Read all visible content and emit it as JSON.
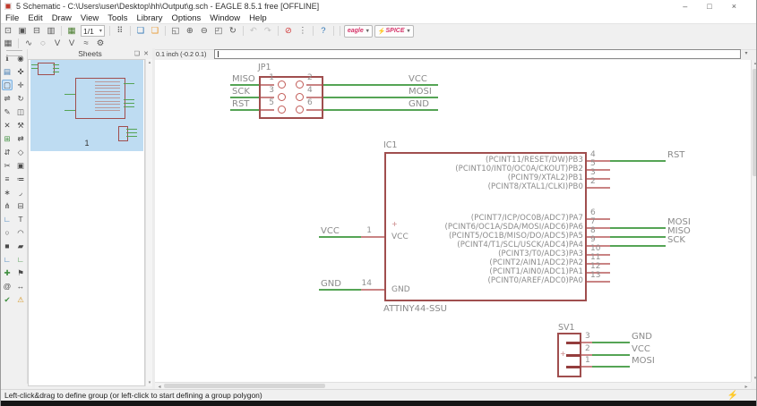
{
  "window": {
    "title": "5 Schematic - C:\\Users\\user\\Desktop\\hh\\Output\\g.sch - EAGLE 8.5.1 free [OFFLINE]",
    "controls": {
      "minimize": "–",
      "maximize": "□",
      "close": "×"
    }
  },
  "menu": {
    "items": [
      "File",
      "Edit",
      "Draw",
      "View",
      "Tools",
      "Library",
      "Options",
      "Window",
      "Help"
    ]
  },
  "toolbar1": {
    "items": [
      {
        "name": "open-icon",
        "glyph": "⊡"
      },
      {
        "name": "save-icon",
        "glyph": "▣"
      },
      {
        "name": "print-icon",
        "glyph": "⊟"
      },
      {
        "name": "image-export-icon",
        "glyph": "▥"
      },
      {
        "sep": true
      },
      {
        "name": "grid-icon",
        "glyph": "▦",
        "color": "#4a7d2f"
      },
      {
        "name": "sheet-selector",
        "dropdown": true,
        "label": "1/1"
      },
      {
        "sep": true
      },
      {
        "name": "modules-icon",
        "glyph": "⠿"
      },
      {
        "sep": true
      },
      {
        "name": "layers-blue-icon",
        "glyph": "❏",
        "color": "#2e75b6"
      },
      {
        "name": "layers-orange-icon",
        "glyph": "❏",
        "color": "#e8972e"
      },
      {
        "sep": true
      },
      {
        "name": "zoom-fit-icon",
        "glyph": "◱"
      },
      {
        "name": "zoom-in-icon",
        "glyph": "⊕"
      },
      {
        "name": "zoom-out-icon",
        "glyph": "⊖"
      },
      {
        "name": "zoom-select-icon",
        "glyph": "◰"
      },
      {
        "name": "zoom-redraw-icon",
        "glyph": "↻"
      },
      {
        "sep": true
      },
      {
        "name": "undo-icon",
        "glyph": "↶",
        "disabled": true
      },
      {
        "name": "redo-icon",
        "glyph": "↷",
        "disabled": true
      },
      {
        "sep": true
      },
      {
        "name": "stop-icon",
        "glyph": "⊘",
        "color": "#d23b3b"
      },
      {
        "name": "dots-icon",
        "glyph": "⋮"
      },
      {
        "sep": true
      },
      {
        "name": "help-icon",
        "glyph": "?",
        "color": "#2e75b6"
      }
    ],
    "eagle_button_label": "eagle",
    "spice_button_label": "SPICE",
    "dropdown_arrow": "▾"
  },
  "toolbar2": {
    "items": [
      {
        "name": "grid-small-icon",
        "glyph": "▦"
      },
      {
        "sep": true
      },
      {
        "name": "net-wave-icon",
        "glyph": "∿"
      },
      {
        "name": "magnify-icon",
        "glyph": "◌"
      },
      {
        "name": "v-high-icon",
        "glyph": "V"
      },
      {
        "name": "v-low-icon",
        "glyph": "V"
      },
      {
        "name": "route-icon",
        "glyph": "≈"
      },
      {
        "name": "gear-icon",
        "glyph": "⚙"
      }
    ]
  },
  "dock": {
    "items": [
      {
        "name": "info-icon",
        "glyph": "ℹ"
      },
      {
        "name": "eye-icon",
        "glyph": "◉"
      },
      {
        "name": "display-layers-icon",
        "glyph": "▤",
        "color": "#3a76ad"
      },
      {
        "name": "mark-icon",
        "glyph": "✜"
      },
      {
        "name": "group-icon",
        "glyph": "▢",
        "selected": true
      },
      {
        "name": "move-icon",
        "glyph": "✛"
      },
      {
        "name": "mirror-icon",
        "glyph": "⇌"
      },
      {
        "name": "rotate-icon",
        "glyph": "↻"
      },
      {
        "name": "change-icon",
        "glyph": "✎"
      },
      {
        "name": "copy-icon",
        "glyph": "◫"
      },
      {
        "name": "delete-icon",
        "glyph": "✕"
      },
      {
        "name": "wrench-icon",
        "glyph": "⚒"
      },
      {
        "name": "add-part-icon",
        "glyph": "⊞",
        "color": "#3f8f3f"
      },
      {
        "name": "pinswap-icon",
        "glyph": "⇄"
      },
      {
        "name": "gateswap-icon",
        "glyph": "⇵"
      },
      {
        "name": "replace-icon",
        "glyph": "◇"
      },
      {
        "name": "cut-icon",
        "glyph": "✂"
      },
      {
        "name": "paste-icon",
        "glyph": "▣"
      },
      {
        "name": "name-icon",
        "glyph": "≡"
      },
      {
        "name": "value-icon",
        "glyph": "≔"
      },
      {
        "name": "smash-icon",
        "glyph": "∗"
      },
      {
        "name": "miter-icon",
        "glyph": "◞"
      },
      {
        "name": "split-icon",
        "glyph": "⋔"
      },
      {
        "name": "invoke-icon",
        "glyph": "⊟"
      },
      {
        "name": "wire-icon",
        "glyph": "∟",
        "color": "#2e75b6"
      },
      {
        "name": "text-icon",
        "glyph": "T"
      },
      {
        "name": "circle-icon",
        "glyph": "○"
      },
      {
        "name": "arc-icon",
        "glyph": "◠"
      },
      {
        "name": "rect-icon",
        "glyph": "■"
      },
      {
        "name": "polygon-icon",
        "glyph": "▰"
      },
      {
        "name": "bus-icon",
        "glyph": "∟",
        "color": "#2e75b6"
      },
      {
        "name": "net-icon",
        "glyph": "∟",
        "color": "#3f8f3f"
      },
      {
        "name": "junction-icon",
        "glyph": "✚",
        "color": "#3f8f3f"
      },
      {
        "name": "label-icon",
        "glyph": "⚑"
      },
      {
        "name": "attribute-icon",
        "glyph": "@"
      },
      {
        "name": "dimension-icon",
        "glyph": "↔"
      },
      {
        "name": "erc-icon",
        "glyph": "✔",
        "color": "#3f8f3f"
      },
      {
        "name": "errors-icon",
        "glyph": "⚠",
        "color": "#d69a2d"
      }
    ]
  },
  "sheets": {
    "title": "Sheets",
    "sheet_number": "1"
  },
  "command": {
    "coords": "0.1 inch (-0.2 0.1)",
    "input_value": ""
  },
  "status": {
    "text": "Left-click&drag to define group (or left-click to start defining a group polygon)"
  },
  "schematic": {
    "jp1": {
      "name": "JP1",
      "rows": [
        {
          "left_net": "MISO",
          "n1": "1",
          "n2": "2",
          "right_net": "VCC"
        },
        {
          "left_net": "SCK",
          "n1": "3",
          "n2": "4",
          "right_net": "MOSI"
        },
        {
          "left_net": "RST",
          "n1": "5",
          "n2": "6",
          "right_net": "GND"
        }
      ]
    },
    "ic1": {
      "name": "IC1",
      "value": "ATTINY44-SSU",
      "left_pins": [
        {
          "number": "1",
          "inner": "VCC",
          "net": "VCC",
          "plus": true
        },
        {
          "number": "14",
          "inner": "GND",
          "net": "GND"
        }
      ],
      "right_pins": [
        {
          "label": "(PCINT11/RESET/DW)PB3",
          "number": "4",
          "net": "RST"
        },
        {
          "label": "(PCINT10/INT0/OC0A/CKOUT)PB2",
          "number": "5"
        },
        {
          "label": "(PCINT9/XTAL2)PB1",
          "number": "3"
        },
        {
          "label": "(PCINT8/XTAL1/CLKI)PB0",
          "number": "2"
        },
        {
          "label": "(PCINT7/ICP/OC0B/ADC7)PA7",
          "number": "6",
          "gap_before": true
        },
        {
          "label": "(PCINT6/OC1A/SDA/MOSI/ADC6)PA6",
          "number": "7",
          "net": "MOSI"
        },
        {
          "label": "(PCINT5/OC1B/MISO/DO/ADC5)PA5",
          "number": "8",
          "net": "MISO"
        },
        {
          "label": "(PCINT4/T1/SCL/USCK/ADC4)PA4",
          "number": "9",
          "net": "SCK"
        },
        {
          "label": "(PCINT3/T0/ADC3)PA3",
          "number": "10"
        },
        {
          "label": "(PCINT2/AIN1/ADC2)PA2",
          "number": "11"
        },
        {
          "label": "(PCINT1/AIN0/ADC1)PA1",
          "number": "12"
        },
        {
          "label": "(PCINT0/AREF/ADC0)PA0",
          "number": "13"
        }
      ]
    },
    "sv1": {
      "name": "SV1",
      "pins": [
        {
          "number": "3",
          "net": "GND"
        },
        {
          "number": "2",
          "net": "VCC"
        },
        {
          "number": "1",
          "net": "MOSI"
        }
      ]
    }
  },
  "colors": {
    "component": "#a04e4e",
    "pin_stub": "#c98383",
    "wire": "#55a455",
    "schematic_text": "#8a8a8a",
    "thumbnail_selected": "#bedcf2",
    "accent_pink": "#d6356a"
  }
}
